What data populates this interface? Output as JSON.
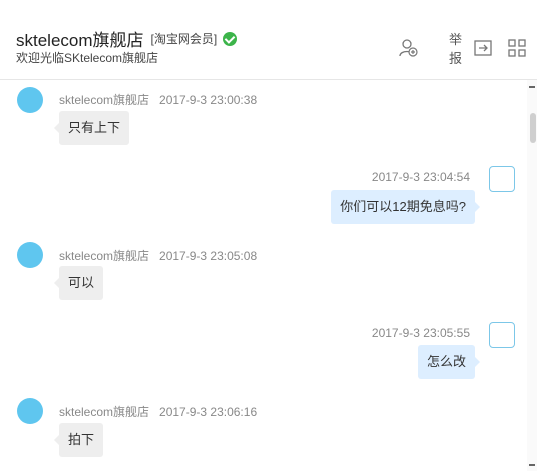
{
  "header": {
    "shop_name": "sktelecom旗舰店",
    "member_tag": "[淘宝网会员]",
    "subtitle": "欢迎光临SKtelecom旗舰店",
    "report_label": "举报"
  },
  "messages": [
    {
      "sender": "sktelecom旗舰店",
      "time": "2017-9-3 23:00:38",
      "text": "只有上下",
      "side": "left"
    },
    {
      "sender": "",
      "time": "2017-9-3 23:04:54",
      "text": "你们可以12期免息吗?",
      "side": "right"
    },
    {
      "sender": "sktelecom旗舰店",
      "time": "2017-9-3 23:05:08",
      "text": "可以",
      "side": "left"
    },
    {
      "sender": "",
      "time": "2017-9-3 23:05:55",
      "text": "怎么改",
      "side": "right"
    },
    {
      "sender": "sktelecom旗舰店",
      "time": "2017-9-3 23:06:16",
      "text": "拍下",
      "side": "left"
    }
  ],
  "icons": {
    "verified": "check-circle-icon",
    "add_contact": "add-user-icon",
    "share": "forward-icon",
    "apps": "grid-icon"
  },
  "colors": {
    "verified": "#3cb44a",
    "left_bubble": "#eeeeee",
    "right_bubble": "#ddeeff",
    "avatar": "#5fc6ef"
  }
}
